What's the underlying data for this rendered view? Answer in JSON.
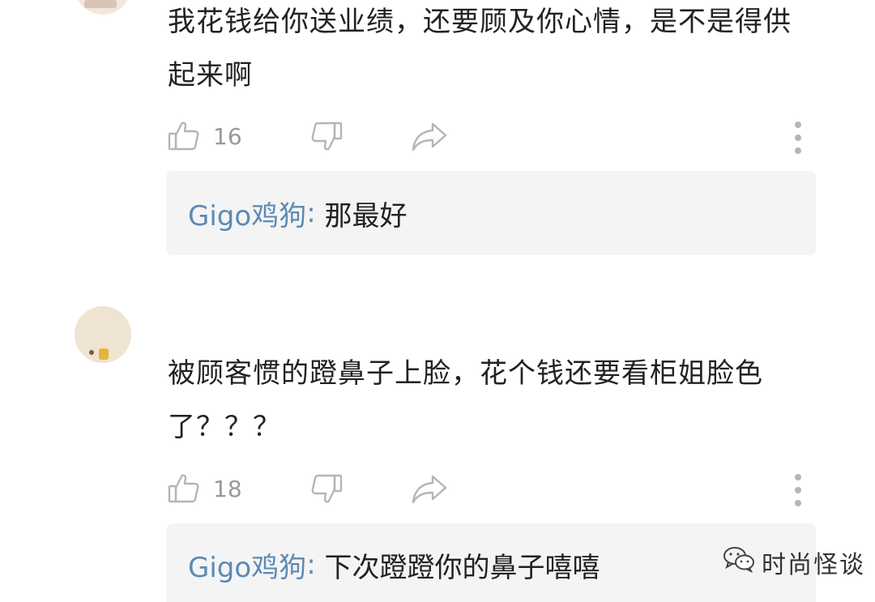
{
  "comments": [
    {
      "text": "我花钱给你送业绩，还要顾及你心情，是不是得供起来啊",
      "like_count": "16",
      "reply": {
        "user": "Gigo鸡狗",
        "separator": ": ",
        "text": "那最好"
      }
    },
    {
      "text": "被顾客惯的蹬鼻子上脸，花个钱还要看柜姐脸色了？？？",
      "like_count": "18",
      "reply": {
        "user": "Gigo鸡狗",
        "separator": ": ",
        "text": "下次蹬蹬你的鼻子嘻嘻"
      }
    }
  ],
  "icons": {
    "like": "thumbs-up-icon",
    "dislike": "thumbs-down-icon",
    "share": "share-arrow-icon",
    "more": "more-vertical-icon",
    "watermark": "wechat-icon"
  },
  "colors": {
    "reply_user": "#5d8ab4",
    "reply_background": "#f4f4f5",
    "icon": "#b5b5b5",
    "count": "#999999",
    "text": "#222222"
  },
  "watermark": {
    "text": "时尚怪谈"
  }
}
